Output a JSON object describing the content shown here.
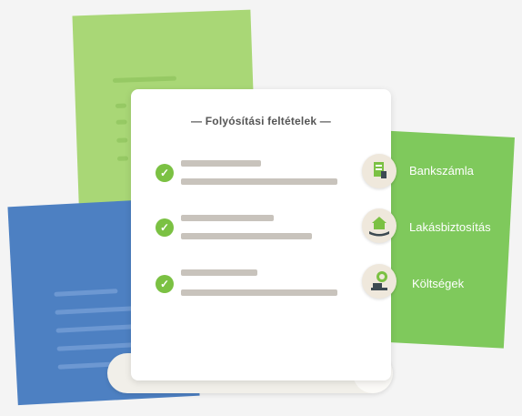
{
  "card": {
    "title": "— Folyósítási feltételek —",
    "conditions": [
      {
        "checked": true
      },
      {
        "checked": true
      },
      {
        "checked": true
      }
    ]
  },
  "features": [
    {
      "label": "Bankszámla",
      "icon": "bank-statement-icon"
    },
    {
      "label": "Lakásbiztosítás",
      "icon": "house-in-hand-icon"
    },
    {
      "label": "Költségek",
      "icon": "coin-stack-icon"
    }
  ],
  "colors": {
    "green_light": "#a9d776",
    "green": "#7fc95c",
    "blue": "#4d80c2",
    "check": "#7bc143"
  }
}
